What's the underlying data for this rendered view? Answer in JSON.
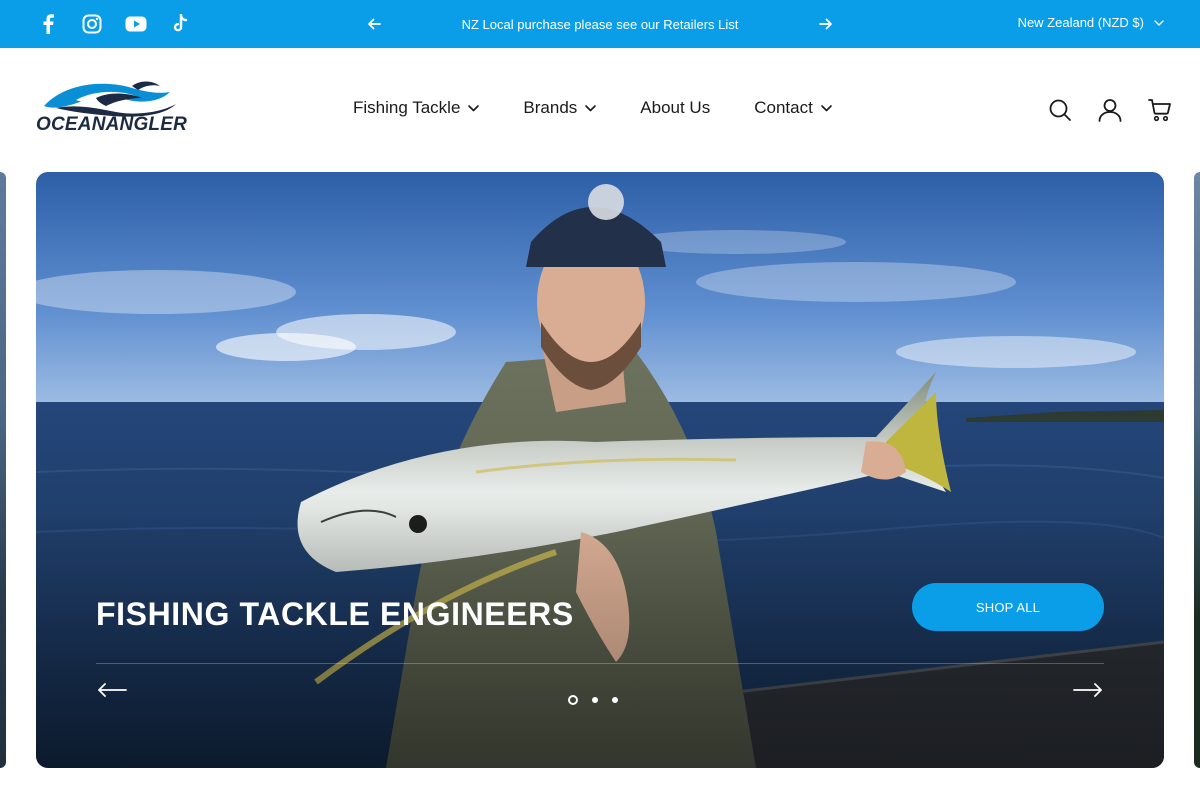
{
  "colors": {
    "accent": "#0a9ee9",
    "header_text": "#1a1a1a",
    "logo_navy": "#1c2a44"
  },
  "topbar": {
    "social_icons": [
      "facebook-icon",
      "instagram-icon",
      "youtube-icon",
      "tiktok-icon"
    ],
    "announcement": "NZ Local purchase please see our Retailers List",
    "currency": "New Zealand (NZD $)"
  },
  "header": {
    "logo_text": "OCEANANGLER",
    "nav": [
      {
        "label": "Fishing Tackle",
        "has_dropdown": true
      },
      {
        "label": "Brands",
        "has_dropdown": true
      },
      {
        "label": "About Us",
        "has_dropdown": false
      },
      {
        "label": "Contact",
        "has_dropdown": true
      }
    ],
    "icons": [
      "search-icon",
      "account-icon",
      "cart-icon"
    ]
  },
  "hero": {
    "title": "FISHING TACKLE ENGINEERS",
    "button": "SHOP ALL",
    "slide_count": 3,
    "active_slide": 1
  }
}
